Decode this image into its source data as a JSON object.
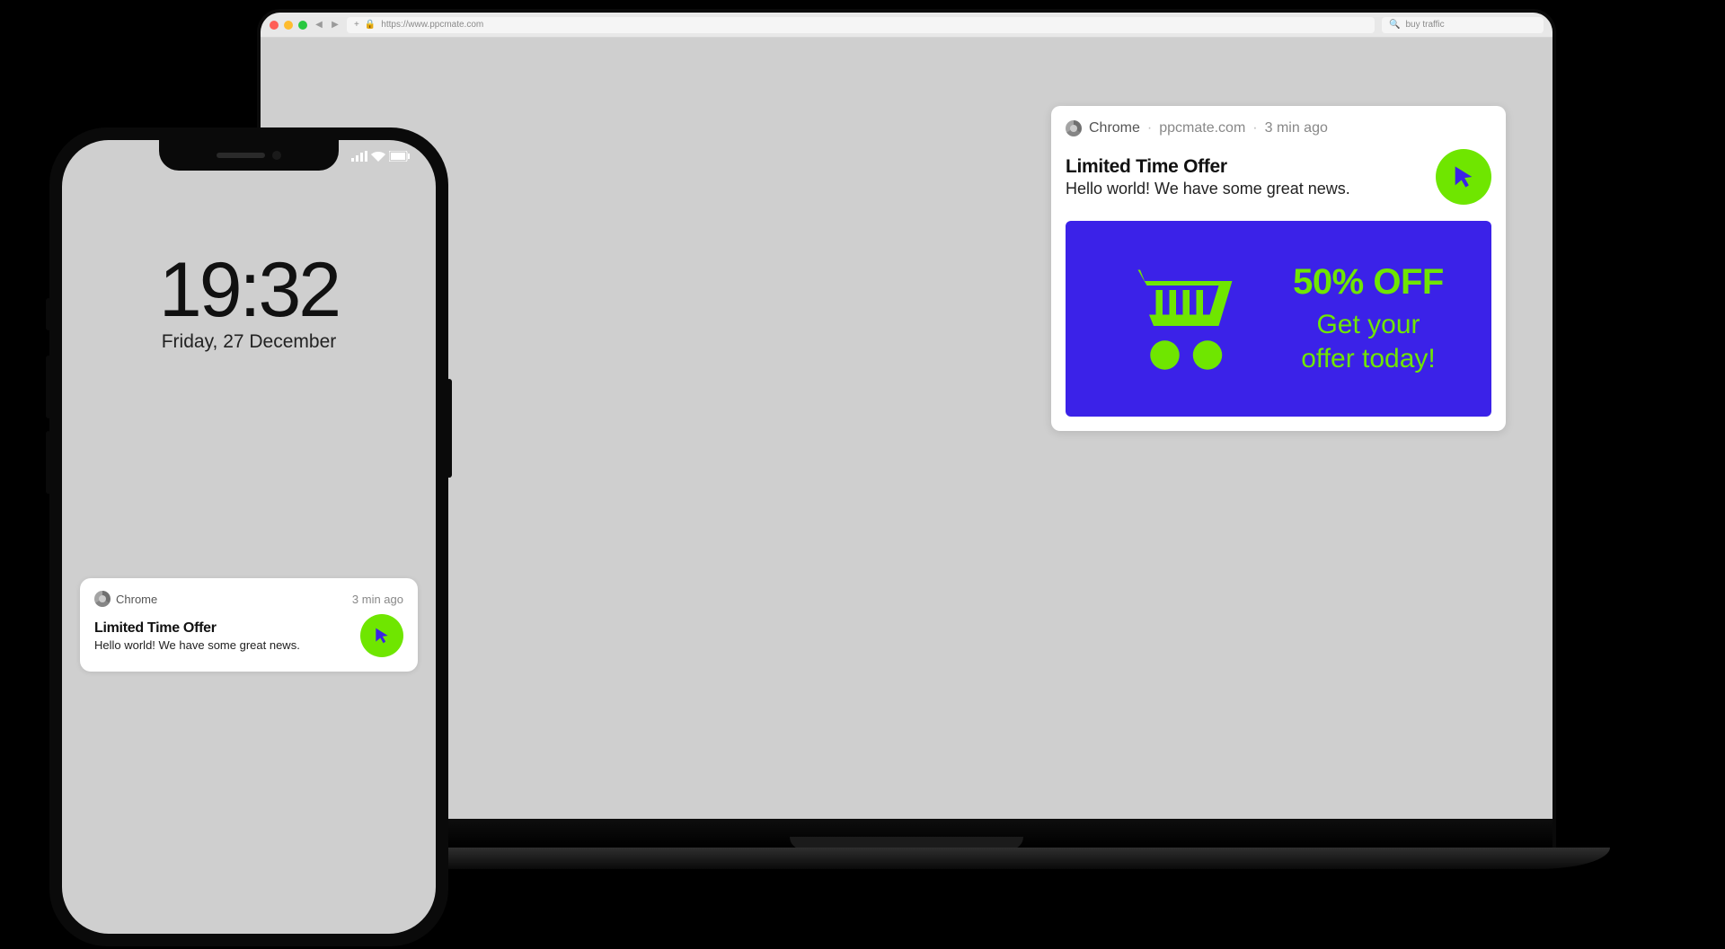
{
  "laptop": {
    "browser": {
      "url": "https://www.ppcmate.com",
      "search_placeholder": "buy traffic"
    },
    "notification": {
      "app": "Chrome",
      "domain": "ppcmate.com",
      "time": "3 min ago",
      "title": "Limited Time Offer",
      "message": "Hello world! We have some great news."
    },
    "promo": {
      "headline": "50% OFF",
      "line1": "Get your",
      "line2": "offer today!"
    }
  },
  "phone": {
    "time": "19:32",
    "date": "Friday, 27 December",
    "notification": {
      "app": "Chrome",
      "time": "3 min ago",
      "title": "Limited Time Offer",
      "message": "Hello world! We have some great news."
    }
  }
}
